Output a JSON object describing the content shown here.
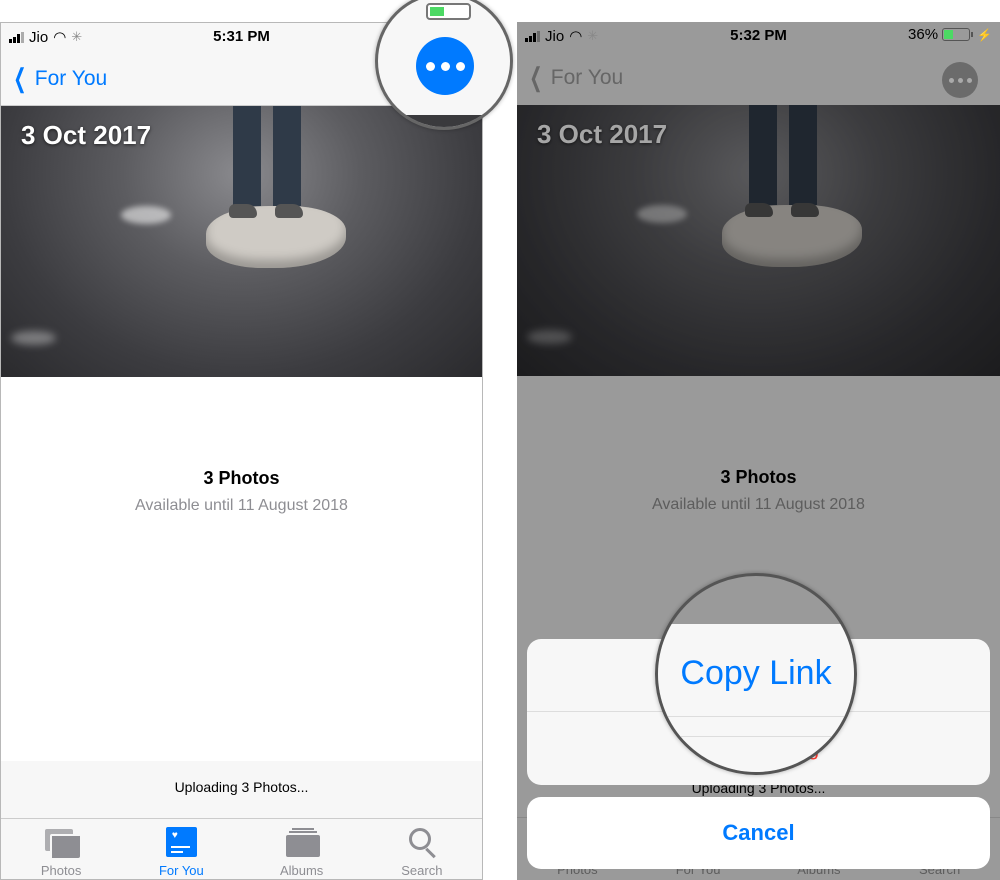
{
  "colors": {
    "accent": "#007aff",
    "destructive": "#ff3b30",
    "battery": "#4cd964"
  },
  "left": {
    "status": {
      "carrier": "Jio",
      "time": "5:31 PM"
    },
    "navbar": {
      "back_label": "For You",
      "more_icon": "ellipsis-icon"
    },
    "photo": {
      "date": "3 Oct 2017"
    },
    "info": {
      "title": "3 Photos",
      "subtitle": "Available until 11 August 2018"
    },
    "upload_status": "Uploading 3 Photos...",
    "tabs": [
      {
        "label": "Photos",
        "icon": "photos-icon",
        "active": false
      },
      {
        "label": "For You",
        "icon": "for-you-icon",
        "active": true
      },
      {
        "label": "Albums",
        "icon": "albums-icon",
        "active": false
      },
      {
        "label": "Search",
        "icon": "search-icon",
        "active": false
      }
    ]
  },
  "right": {
    "status": {
      "carrier": "Jio",
      "time": "5:32 PM",
      "battery": "36%",
      "battery_level": 0.36
    },
    "navbar": {
      "back_label": "For You"
    },
    "photo": {
      "date": "3 Oct 2017"
    },
    "info": {
      "title": "3 Photos",
      "subtitle": "Available until 11 August 2018"
    },
    "upload_status": "Uploading 3 Photos...",
    "tabs": [
      {
        "label": "Photos"
      },
      {
        "label": "For You"
      },
      {
        "label": "Albums"
      },
      {
        "label": "Search"
      }
    ],
    "action_sheet": {
      "copy_link": "Copy Link",
      "stop_sharing": "Stop Sharing",
      "stop_sharing_visible": "S                g",
      "cancel": "Cancel"
    }
  }
}
